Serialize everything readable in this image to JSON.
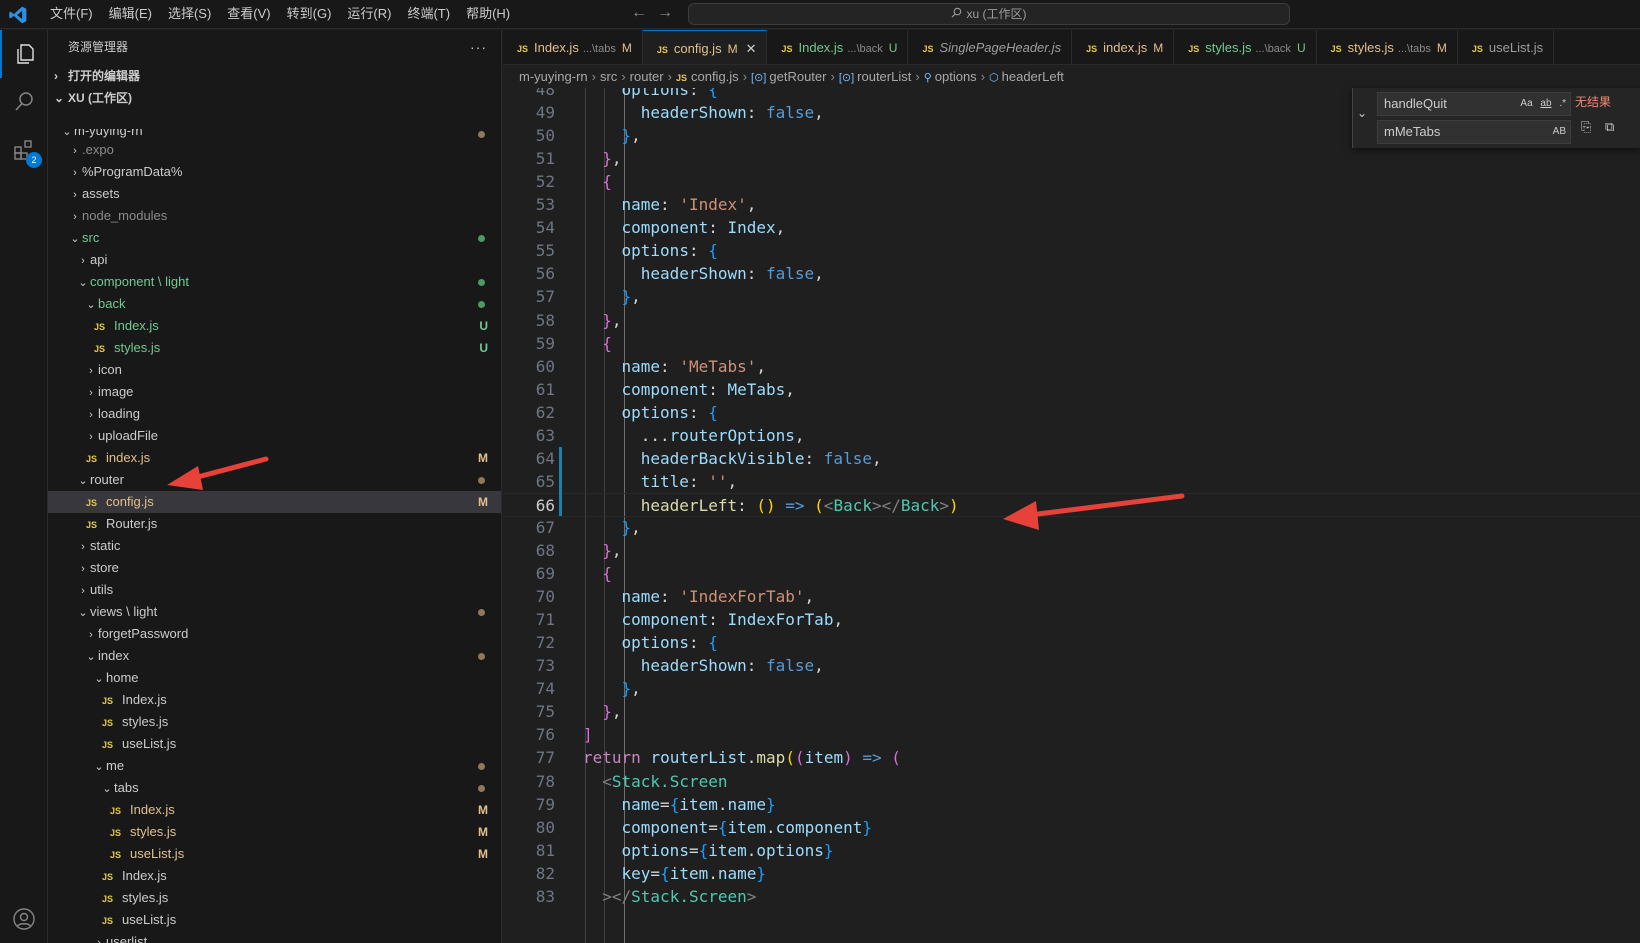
{
  "titlebar": {
    "menu": [
      "文件(F)",
      "编辑(E)",
      "选择(S)",
      "查看(V)",
      "转到(G)",
      "运行(R)",
      "终端(T)",
      "帮助(H)"
    ],
    "search_text": "xu (工作区)"
  },
  "activitybar": {
    "extensions_badge": "2"
  },
  "sidebar": {
    "title": "资源管理器",
    "more": "···",
    "open_editors": "打开的编辑器",
    "workspace": "XU (工作区)",
    "tree": [
      {
        "label": "m-yuying-rn",
        "depth": 1,
        "kind": "folder-open",
        "status": "dot",
        "partial": true
      },
      {
        "label": ".expo",
        "depth": 2,
        "kind": "folder",
        "dim": true
      },
      {
        "label": "%ProgramData%",
        "depth": 2,
        "kind": "folder"
      },
      {
        "label": "assets",
        "depth": 2,
        "kind": "folder"
      },
      {
        "label": "node_modules",
        "depth": 2,
        "kind": "folder",
        "dim": true
      },
      {
        "label": "src",
        "depth": 2,
        "kind": "folder-open",
        "status": "dot-green",
        "green": true
      },
      {
        "label": "api",
        "depth": 3,
        "kind": "folder"
      },
      {
        "label": "component \\ light",
        "depth": 3,
        "kind": "folder-open",
        "status": "dot-green",
        "green": true
      },
      {
        "label": "back",
        "depth": 4,
        "kind": "folder-open",
        "status": "dot-green",
        "green": true
      },
      {
        "label": "Index.js",
        "depth": 5,
        "kind": "js",
        "status": "U"
      },
      {
        "label": "styles.js",
        "depth": 5,
        "kind": "js",
        "status": "U"
      },
      {
        "label": "icon",
        "depth": 4,
        "kind": "folder"
      },
      {
        "label": "image",
        "depth": 4,
        "kind": "folder"
      },
      {
        "label": "loading",
        "depth": 4,
        "kind": "folder"
      },
      {
        "label": "uploadFile",
        "depth": 4,
        "kind": "folder"
      },
      {
        "label": "index.js",
        "depth": 4,
        "kind": "js",
        "status": "M"
      },
      {
        "label": "router",
        "depth": 3,
        "kind": "folder-open",
        "status": "dot"
      },
      {
        "label": "config.js",
        "depth": 4,
        "kind": "js",
        "status": "M",
        "selected": true
      },
      {
        "label": "Router.js",
        "depth": 4,
        "kind": "js"
      },
      {
        "label": "static",
        "depth": 3,
        "kind": "folder"
      },
      {
        "label": "store",
        "depth": 3,
        "kind": "folder"
      },
      {
        "label": "utils",
        "depth": 3,
        "kind": "folder"
      },
      {
        "label": "views \\ light",
        "depth": 3,
        "kind": "folder-open",
        "status": "dot"
      },
      {
        "label": "forgetPassword",
        "depth": 4,
        "kind": "folder"
      },
      {
        "label": "index",
        "depth": 4,
        "kind": "folder-open",
        "status": "dot"
      },
      {
        "label": "home",
        "depth": 5,
        "kind": "folder-open"
      },
      {
        "label": "Index.js",
        "depth": 6,
        "kind": "js"
      },
      {
        "label": "styles.js",
        "depth": 6,
        "kind": "js"
      },
      {
        "label": "useList.js",
        "depth": 6,
        "kind": "js"
      },
      {
        "label": "me",
        "depth": 5,
        "kind": "folder-open",
        "status": "dot"
      },
      {
        "label": "tabs",
        "depth": 6,
        "kind": "folder-open",
        "status": "dot"
      },
      {
        "label": "Index.js",
        "depth": 7,
        "kind": "js",
        "status": "M"
      },
      {
        "label": "styles.js",
        "depth": 7,
        "kind": "js",
        "status": "M"
      },
      {
        "label": "useList.js",
        "depth": 7,
        "kind": "js",
        "status": "M"
      },
      {
        "label": "Index.js",
        "depth": 6,
        "kind": "js"
      },
      {
        "label": "styles.js",
        "depth": 6,
        "kind": "js"
      },
      {
        "label": "useList.js",
        "depth": 6,
        "kind": "js"
      },
      {
        "label": "userlist",
        "depth": 5,
        "kind": "folder"
      }
    ]
  },
  "tabs": [
    {
      "name": "Index.js",
      "path": "...\\tabs",
      "status": "M",
      "italic": false
    },
    {
      "name": "config.js",
      "path": "",
      "status": "M",
      "active": true,
      "close": "✕"
    },
    {
      "name": "Index.js",
      "path": "...\\back",
      "status": "U"
    },
    {
      "name": "SinglePageHeader.js",
      "path": "",
      "status": "",
      "italic": true
    },
    {
      "name": "index.js",
      "path": "",
      "status": "M"
    },
    {
      "name": "styles.js",
      "path": "...\\back",
      "status": "U"
    },
    {
      "name": "styles.js",
      "path": "...\\tabs",
      "status": "M"
    },
    {
      "name": "useList.js",
      "path": "",
      "status": ""
    }
  ],
  "breadcrumbs": [
    "m-yuying-rn",
    "src",
    "router",
    "config.js",
    "getRouter",
    "routerList",
    "options",
    "headerLeft"
  ],
  "find": {
    "find_value": "handleQuit",
    "replace_value": "mMeTabs",
    "status": "无结果",
    "opt_case": "Aa",
    "opt_word": "ab",
    "opt_regex": ".*",
    "opt_preserve": "AB"
  },
  "editor": {
    "current_line": 66,
    "lines": [
      {
        "n": 48,
        "indent": 2,
        "t": [
          [
            "options",
            "prop"
          ],
          [
            ": ",
            "def"
          ],
          [
            "{",
            "b3"
          ]
        ]
      },
      {
        "n": 49,
        "indent": 3,
        "t": [
          [
            "headerShown",
            "prop"
          ],
          [
            ": ",
            "def"
          ],
          [
            "false",
            "ctl"
          ],
          [
            ",",
            "def"
          ]
        ]
      },
      {
        "n": 50,
        "indent": 2,
        "t": [
          [
            "}",
            "b3"
          ],
          [
            ",",
            "def"
          ]
        ]
      },
      {
        "n": 51,
        "indent": 1,
        "t": [
          [
            "}",
            "b2"
          ],
          [
            ",",
            "def"
          ]
        ]
      },
      {
        "n": 52,
        "indent": 1,
        "t": [
          [
            "{",
            "b2"
          ]
        ]
      },
      {
        "n": 53,
        "indent": 2,
        "t": [
          [
            "name",
            "prop"
          ],
          [
            ": ",
            "def"
          ],
          [
            "'Index'",
            "str"
          ],
          [
            ",",
            "def"
          ]
        ]
      },
      {
        "n": 54,
        "indent": 2,
        "t": [
          [
            "component",
            "prop"
          ],
          [
            ": ",
            "def"
          ],
          [
            "Index",
            "var"
          ],
          [
            ",",
            "def"
          ]
        ]
      },
      {
        "n": 55,
        "indent": 2,
        "t": [
          [
            "options",
            "prop"
          ],
          [
            ": ",
            "def"
          ],
          [
            "{",
            "b3"
          ]
        ]
      },
      {
        "n": 56,
        "indent": 3,
        "t": [
          [
            "headerShown",
            "prop"
          ],
          [
            ": ",
            "def"
          ],
          [
            "false",
            "ctl"
          ],
          [
            ",",
            "def"
          ]
        ]
      },
      {
        "n": 57,
        "indent": 2,
        "t": [
          [
            "}",
            "b3"
          ],
          [
            ",",
            "def"
          ]
        ]
      },
      {
        "n": 58,
        "indent": 1,
        "t": [
          [
            "}",
            "b2"
          ],
          [
            ",",
            "def"
          ]
        ]
      },
      {
        "n": 59,
        "indent": 1,
        "t": [
          [
            "{",
            "b2"
          ]
        ]
      },
      {
        "n": 60,
        "indent": 2,
        "t": [
          [
            "name",
            "prop"
          ],
          [
            ": ",
            "def"
          ],
          [
            "'MeTabs'",
            "str"
          ],
          [
            ",",
            "def"
          ]
        ]
      },
      {
        "n": 61,
        "indent": 2,
        "t": [
          [
            "component",
            "prop"
          ],
          [
            ": ",
            "def"
          ],
          [
            "MeTabs",
            "var"
          ],
          [
            ",",
            "def"
          ]
        ]
      },
      {
        "n": 62,
        "indent": 2,
        "t": [
          [
            "options",
            "prop"
          ],
          [
            ": ",
            "def"
          ],
          [
            "{",
            "b3"
          ]
        ]
      },
      {
        "n": 63,
        "indent": 3,
        "t": [
          [
            "...",
            "def"
          ],
          [
            "routerOptions",
            "var"
          ],
          [
            ",",
            "def"
          ]
        ]
      },
      {
        "n": 64,
        "indent": 3,
        "t": [
          [
            "headerBackVisible",
            "prop"
          ],
          [
            ": ",
            "def"
          ],
          [
            "false",
            "ctl"
          ],
          [
            ",",
            "def"
          ]
        ]
      },
      {
        "n": 65,
        "indent": 3,
        "t": [
          [
            "title",
            "prop"
          ],
          [
            ": ",
            "def"
          ],
          [
            "''",
            "str"
          ],
          [
            ",",
            "def"
          ]
        ]
      },
      {
        "n": 66,
        "indent": 3,
        "t": [
          [
            "headerLeft",
            "fn"
          ],
          [
            ": ",
            "def"
          ],
          [
            "()",
            "b1"
          ],
          [
            " => ",
            "ctl"
          ],
          [
            "(",
            "b1"
          ],
          [
            "<",
            "tag"
          ],
          [
            "Back",
            "jsx"
          ],
          [
            "></",
            "tag"
          ],
          [
            "Back",
            "jsx"
          ],
          [
            ">",
            "tag"
          ],
          [
            ")",
            "b1"
          ]
        ]
      },
      {
        "n": 67,
        "indent": 2,
        "t": [
          [
            "}",
            "b3"
          ],
          [
            ",",
            "def"
          ]
        ]
      },
      {
        "n": 68,
        "indent": 1,
        "t": [
          [
            "}",
            "b2"
          ],
          [
            ",",
            "def"
          ]
        ]
      },
      {
        "n": 69,
        "indent": 1,
        "t": [
          [
            "{",
            "b2"
          ]
        ]
      },
      {
        "n": 70,
        "indent": 2,
        "t": [
          [
            "name",
            "prop"
          ],
          [
            ": ",
            "def"
          ],
          [
            "'IndexForTab'",
            "str"
          ],
          [
            ",",
            "def"
          ]
        ]
      },
      {
        "n": 71,
        "indent": 2,
        "t": [
          [
            "component",
            "prop"
          ],
          [
            ": ",
            "def"
          ],
          [
            "IndexForTab",
            "var"
          ],
          [
            ",",
            "def"
          ]
        ]
      },
      {
        "n": 72,
        "indent": 2,
        "t": [
          [
            "options",
            "prop"
          ],
          [
            ": ",
            "def"
          ],
          [
            "{",
            "b3"
          ]
        ]
      },
      {
        "n": 73,
        "indent": 3,
        "t": [
          [
            "headerShown",
            "prop"
          ],
          [
            ": ",
            "def"
          ],
          [
            "false",
            "ctl"
          ],
          [
            ",",
            "def"
          ]
        ]
      },
      {
        "n": 74,
        "indent": 2,
        "t": [
          [
            "}",
            "b3"
          ],
          [
            ",",
            "def"
          ]
        ]
      },
      {
        "n": 75,
        "indent": 1,
        "t": [
          [
            "}",
            "b2"
          ],
          [
            ",",
            "def"
          ]
        ]
      },
      {
        "n": 76,
        "indent": 0,
        "t": [
          [
            "]",
            "b2"
          ]
        ]
      },
      {
        "n": 77,
        "indent": 0,
        "t": [
          [
            "return ",
            "kw"
          ],
          [
            "routerList",
            "var"
          ],
          [
            ".",
            "def"
          ],
          [
            "map",
            "fn"
          ],
          [
            "(",
            "b1"
          ],
          [
            "(",
            "b2"
          ],
          [
            "item",
            "var"
          ],
          [
            ")",
            "b2"
          ],
          [
            " => ",
            "ctl"
          ],
          [
            "(",
            "b2"
          ]
        ]
      },
      {
        "n": 78,
        "indent": 1,
        "t": [
          [
            "<",
            "tag"
          ],
          [
            "Stack.Screen",
            "jsx"
          ]
        ]
      },
      {
        "n": 79,
        "indent": 2,
        "t": [
          [
            "name",
            "prop"
          ],
          [
            "=",
            "def"
          ],
          [
            "{",
            "b3"
          ],
          [
            "item",
            "var"
          ],
          [
            ".",
            "def"
          ],
          [
            "name",
            "prop"
          ],
          [
            "}",
            "b3"
          ]
        ]
      },
      {
        "n": 80,
        "indent": 2,
        "t": [
          [
            "component",
            "prop"
          ],
          [
            "=",
            "def"
          ],
          [
            "{",
            "b3"
          ],
          [
            "item",
            "var"
          ],
          [
            ".",
            "def"
          ],
          [
            "component",
            "prop"
          ],
          [
            "}",
            "b3"
          ]
        ]
      },
      {
        "n": 81,
        "indent": 2,
        "t": [
          [
            "options",
            "prop"
          ],
          [
            "=",
            "def"
          ],
          [
            "{",
            "b3"
          ],
          [
            "item",
            "var"
          ],
          [
            ".",
            "def"
          ],
          [
            "options",
            "prop"
          ],
          [
            "}",
            "b3"
          ]
        ]
      },
      {
        "n": 82,
        "indent": 2,
        "t": [
          [
            "key",
            "prop"
          ],
          [
            "=",
            "def"
          ],
          [
            "{",
            "b3"
          ],
          [
            "item",
            "var"
          ],
          [
            ".",
            "def"
          ],
          [
            "name",
            "prop"
          ],
          [
            "}",
            "b3"
          ]
        ]
      },
      {
        "n": 83,
        "indent": 1,
        "t": [
          [
            "></",
            "tag"
          ],
          [
            "Stack.Screen",
            "jsx"
          ],
          [
            ">",
            "tag"
          ]
        ]
      }
    ]
  },
  "colors": {
    "accent": "#0078d4",
    "annotation_arrow": "#e8413a",
    "modified": "#e2c08d",
    "untracked": "#73c991"
  }
}
